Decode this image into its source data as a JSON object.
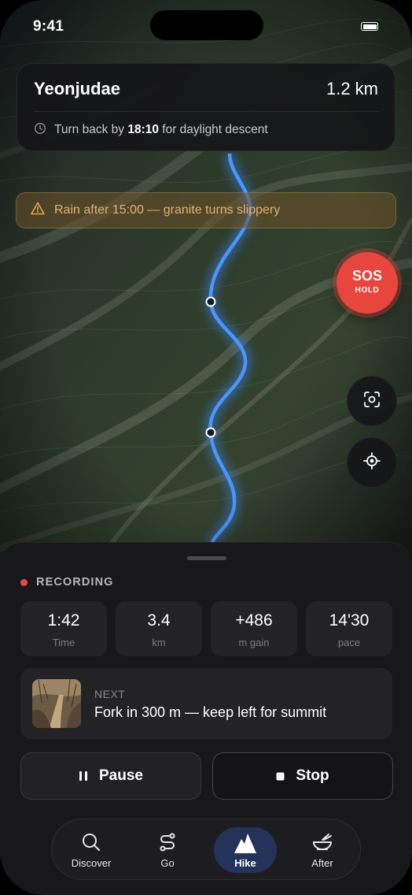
{
  "status_bar": {
    "time": "9:41"
  },
  "destination": {
    "name": "Yeonjudae",
    "distance": "1.2 km",
    "advice_prefix": "Turn back by ",
    "advice_time": "18:10",
    "advice_suffix": " for daylight descent"
  },
  "warning": {
    "text": "Rain after 15:00 — granite turns slippery",
    "icon": "warning-triangle-icon"
  },
  "sos": {
    "label": "SOS",
    "sublabel": "HOLD",
    "color": "#e8453c"
  },
  "map_controls": {
    "scan_icon": "scan-icon",
    "locate_icon": "crosshair-icon"
  },
  "recording": {
    "label": "RECORDING"
  },
  "stats": [
    {
      "value": "1:42",
      "label": "Time"
    },
    {
      "value": "3.4",
      "label": "km"
    },
    {
      "value": "+486",
      "label": "m gain"
    },
    {
      "value": "14'30",
      "label": "pace"
    }
  ],
  "next": {
    "label": "NEXT",
    "instruction": "Fork in 300 m — keep left for summit"
  },
  "actions": {
    "pause": "Pause",
    "stop": "Stop"
  },
  "tabs": [
    {
      "label": "Discover",
      "icon": "search-icon",
      "active": false
    },
    {
      "label": "Go",
      "icon": "route-icon",
      "active": false
    },
    {
      "label": "Hike",
      "icon": "mountain-icon",
      "active": true
    },
    {
      "label": "After",
      "icon": "bowl-icon",
      "active": false
    }
  ],
  "colors": {
    "route": "#3d8bff",
    "accent_tab": "#24335a",
    "warning": "#e7b06c"
  }
}
